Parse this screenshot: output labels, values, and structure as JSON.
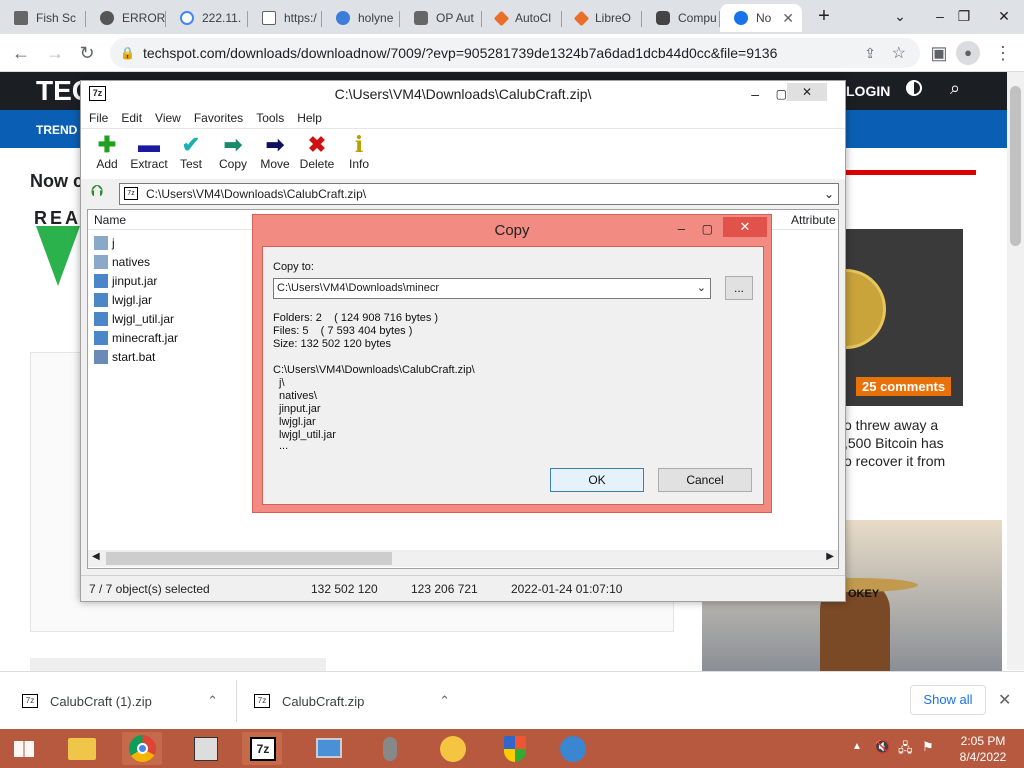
{
  "browser": {
    "tabs": [
      {
        "title": "Fish Sc"
      },
      {
        "title": "ERROR"
      },
      {
        "title": "222.11."
      },
      {
        "title": "https:/"
      },
      {
        "title": "holyne"
      },
      {
        "title": "OP Aut"
      },
      {
        "title": "AutoCl"
      },
      {
        "title": "LibreO"
      },
      {
        "title": "Compu"
      },
      {
        "title": "No"
      }
    ],
    "new_tab": "+",
    "url": "techspot.com/downloads/downloadnow/7009/?evp=905281739de1324b7a6dad1dcb44d0cc&file=9136"
  },
  "website": {
    "logo": "TEC",
    "login": "LOGIN",
    "nav": "TREND",
    "heading": "Now c",
    "logo2": "REA",
    "comments_badge": "25 comments",
    "snippet": [
      "o threw away a",
      ",500 Bitcoin has",
      "o recover it from"
    ],
    "smokey": "OKEY"
  },
  "sevenzip": {
    "title": "C:\\Users\\VM4\\Downloads\\CalubCraft.zip\\",
    "menu": [
      "File",
      "Edit",
      "View",
      "Favorites",
      "Tools",
      "Help"
    ],
    "toolbar": [
      {
        "label": "Add",
        "icon": "add-icon"
      },
      {
        "label": "Extract",
        "icon": "extract-icon"
      },
      {
        "label": "Test",
        "icon": "test-icon"
      },
      {
        "label": "Copy",
        "icon": "copy-icon"
      },
      {
        "label": "Move",
        "icon": "move-icon"
      },
      {
        "label": "Delete",
        "icon": "delete-icon"
      },
      {
        "label": "Info",
        "icon": "info-icon"
      }
    ],
    "path": "C:\\Users\\VM4\\Downloads\\CalubCraft.zip\\",
    "columns": {
      "name": "Name",
      "attributes": "Attribute"
    },
    "files": [
      {
        "name": "j",
        "type": "folder"
      },
      {
        "name": "natives",
        "type": "folder"
      },
      {
        "name": "jinput.jar",
        "type": "jar"
      },
      {
        "name": "lwjgl.jar",
        "type": "jar"
      },
      {
        "name": "lwjgl_util.jar",
        "type": "jar"
      },
      {
        "name": "minecraft.jar",
        "type": "jar"
      },
      {
        "name": "start.bat",
        "type": "bat"
      }
    ],
    "status": {
      "selected": "7 / 7 object(s) selected",
      "size": "132 502 120",
      "packed": "123 206 721",
      "modified": "2022-01-24 01:07:10"
    }
  },
  "copy_dialog": {
    "title": "Copy",
    "copy_to_label": "Copy to:",
    "copy_to_value": "C:\\Users\\VM4\\Downloads\\minecr",
    "browse": "...",
    "folders": "Folders: 2    ( 124 908 716 bytes )",
    "files": "Files: 5    ( 7 593 404 bytes )",
    "size": "Size: 132 502 120 bytes",
    "source": "C:\\Users\\VM4\\Downloads\\CalubCraft.zip\\",
    "items": [
      "j\\",
      "natives\\",
      "jinput.jar",
      "lwjgl.jar",
      "lwjgl_util.jar",
      "..."
    ],
    "ok": "OK",
    "cancel": "Cancel"
  },
  "downloads": {
    "items": [
      "CalubCraft (1).zip",
      "CalubCraft.zip"
    ],
    "show_all": "Show all"
  },
  "taskbar": {
    "time": "2:05 PM",
    "date": "8/4/2022"
  }
}
